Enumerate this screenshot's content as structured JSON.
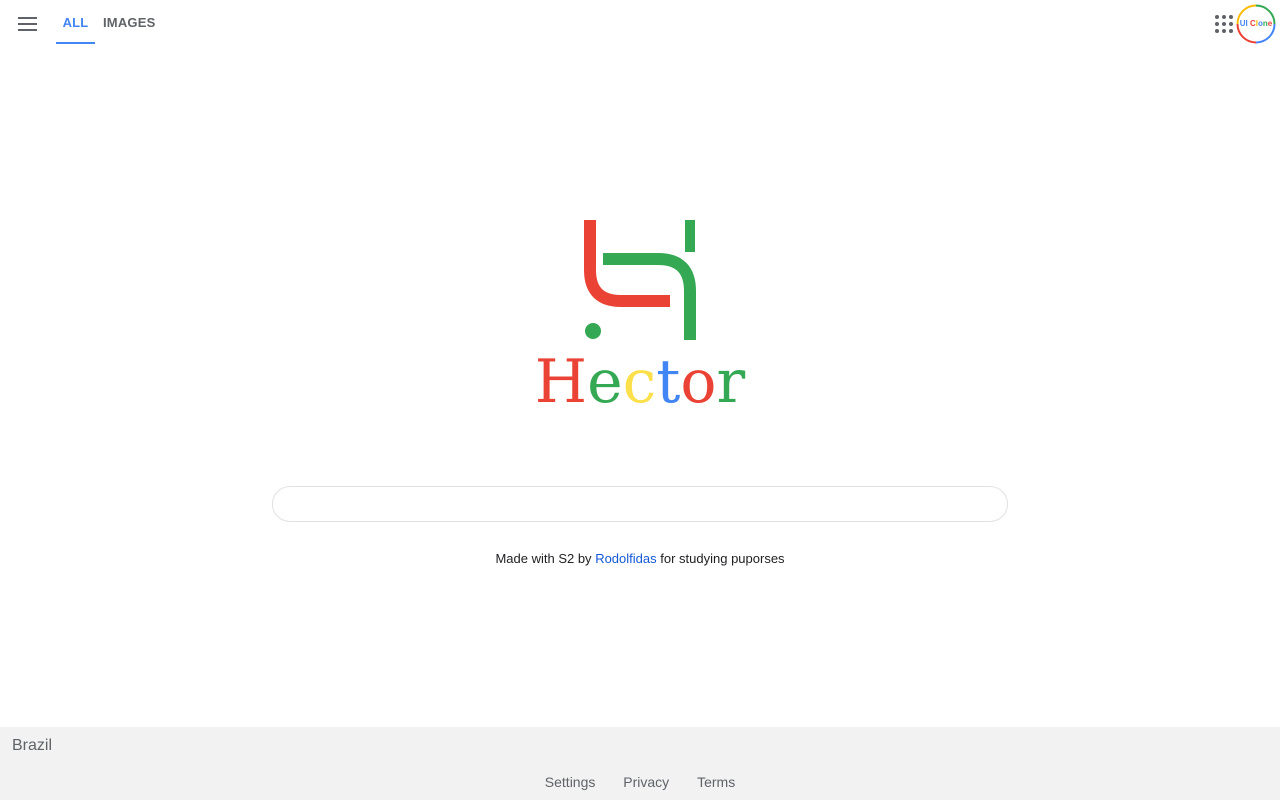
{
  "nav": {
    "tabs": [
      {
        "label": "ALL",
        "active": true
      },
      {
        "label": "IMAGES",
        "active": false
      }
    ],
    "accent_color": "#4285f4"
  },
  "profile": {
    "avatar_text": "UI Clone"
  },
  "logo": {
    "brand_letters": [
      {
        "char": "H",
        "color": "#ea4335"
      },
      {
        "char": "e",
        "color": "#34a853"
      },
      {
        "char": "c",
        "color": "#fbe04b"
      },
      {
        "char": "t",
        "color": "#4285f4"
      },
      {
        "char": "o",
        "color": "#ea4335"
      },
      {
        "char": "r",
        "color": "#34a853"
      }
    ],
    "mark_colors": {
      "red": "#ea4335",
      "green": "#34a853"
    }
  },
  "search": {
    "value": "",
    "placeholder": ""
  },
  "credit": {
    "prefix": "Made with S2 by",
    "author": "Rodolfidas",
    "suffix": "for studying puporses"
  },
  "footer": {
    "country": "Brazil",
    "links": [
      "Settings",
      "Privacy",
      "Terms"
    ]
  }
}
